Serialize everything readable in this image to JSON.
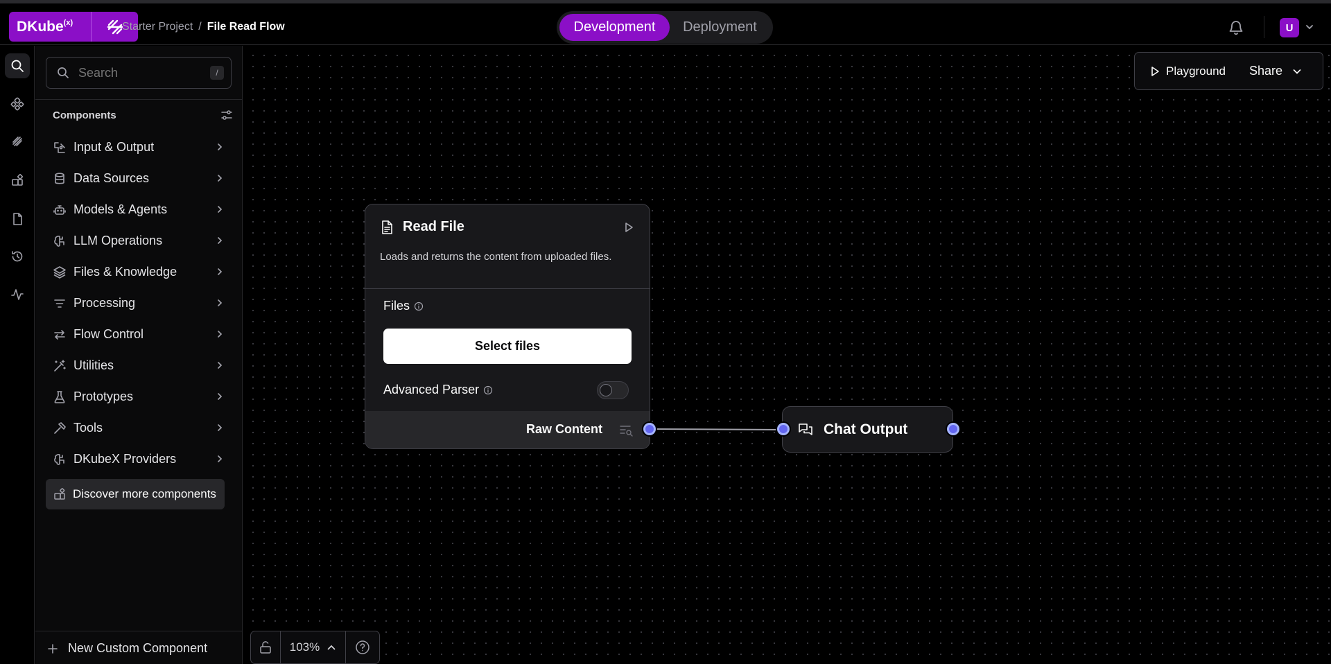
{
  "app": {
    "logo_text": "DKube",
    "logo_sup": "(x)"
  },
  "breadcrumb": {
    "parent": "Starter Project",
    "separator": "/",
    "current": "File Read Flow"
  },
  "mode_toggle": {
    "options": [
      "Development",
      "Deployment"
    ],
    "selected": "Development"
  },
  "user": {
    "avatar_initial": "U"
  },
  "rail": {
    "icons": [
      "search-icon",
      "components-icon",
      "bundles-icon",
      "apps-icon",
      "page-icon",
      "history-icon",
      "activity-icon"
    ],
    "active": "search-icon"
  },
  "sidebar": {
    "search_placeholder": "Search",
    "search_shortcut": "/",
    "components_title": "Components",
    "categories": [
      {
        "label": "Input & Output",
        "icon": "input-output-icon"
      },
      {
        "label": "Data Sources",
        "icon": "database-icon"
      },
      {
        "label": "Models & Agents",
        "icon": "bot-icon"
      },
      {
        "label": "LLM Operations",
        "icon": "brain-icon"
      },
      {
        "label": "Files & Knowledge",
        "icon": "layers-icon"
      },
      {
        "label": "Processing",
        "icon": "filter-icon"
      },
      {
        "label": "Flow Control",
        "icon": "arrows-icon"
      },
      {
        "label": "Utilities",
        "icon": "wand-icon"
      },
      {
        "label": "Prototypes",
        "icon": "flask-icon"
      },
      {
        "label": "Tools",
        "icon": "hammer-icon"
      },
      {
        "label": "DKubeX Providers",
        "icon": "brain-icon"
      }
    ],
    "discover_label": "Discover more components",
    "new_custom_label": "New Custom Component"
  },
  "canvas_toolbar": {
    "playground_label": "Playground",
    "share_label": "Share"
  },
  "read_file_node": {
    "title": "Read File",
    "description": "Loads and returns the content from uploaded files.",
    "files_label": "Files",
    "select_files_label": "Select files",
    "advanced_parser_label": "Advanced Parser",
    "advanced_parser_enabled": false,
    "output_label": "Raw Content"
  },
  "chat_output_node": {
    "title": "Chat Output"
  },
  "bottom_controls": {
    "zoom": "103%"
  },
  "colors": {
    "accent": "#8b0fc7",
    "handle": "#6366f1",
    "canvas_bg": "#000000"
  }
}
